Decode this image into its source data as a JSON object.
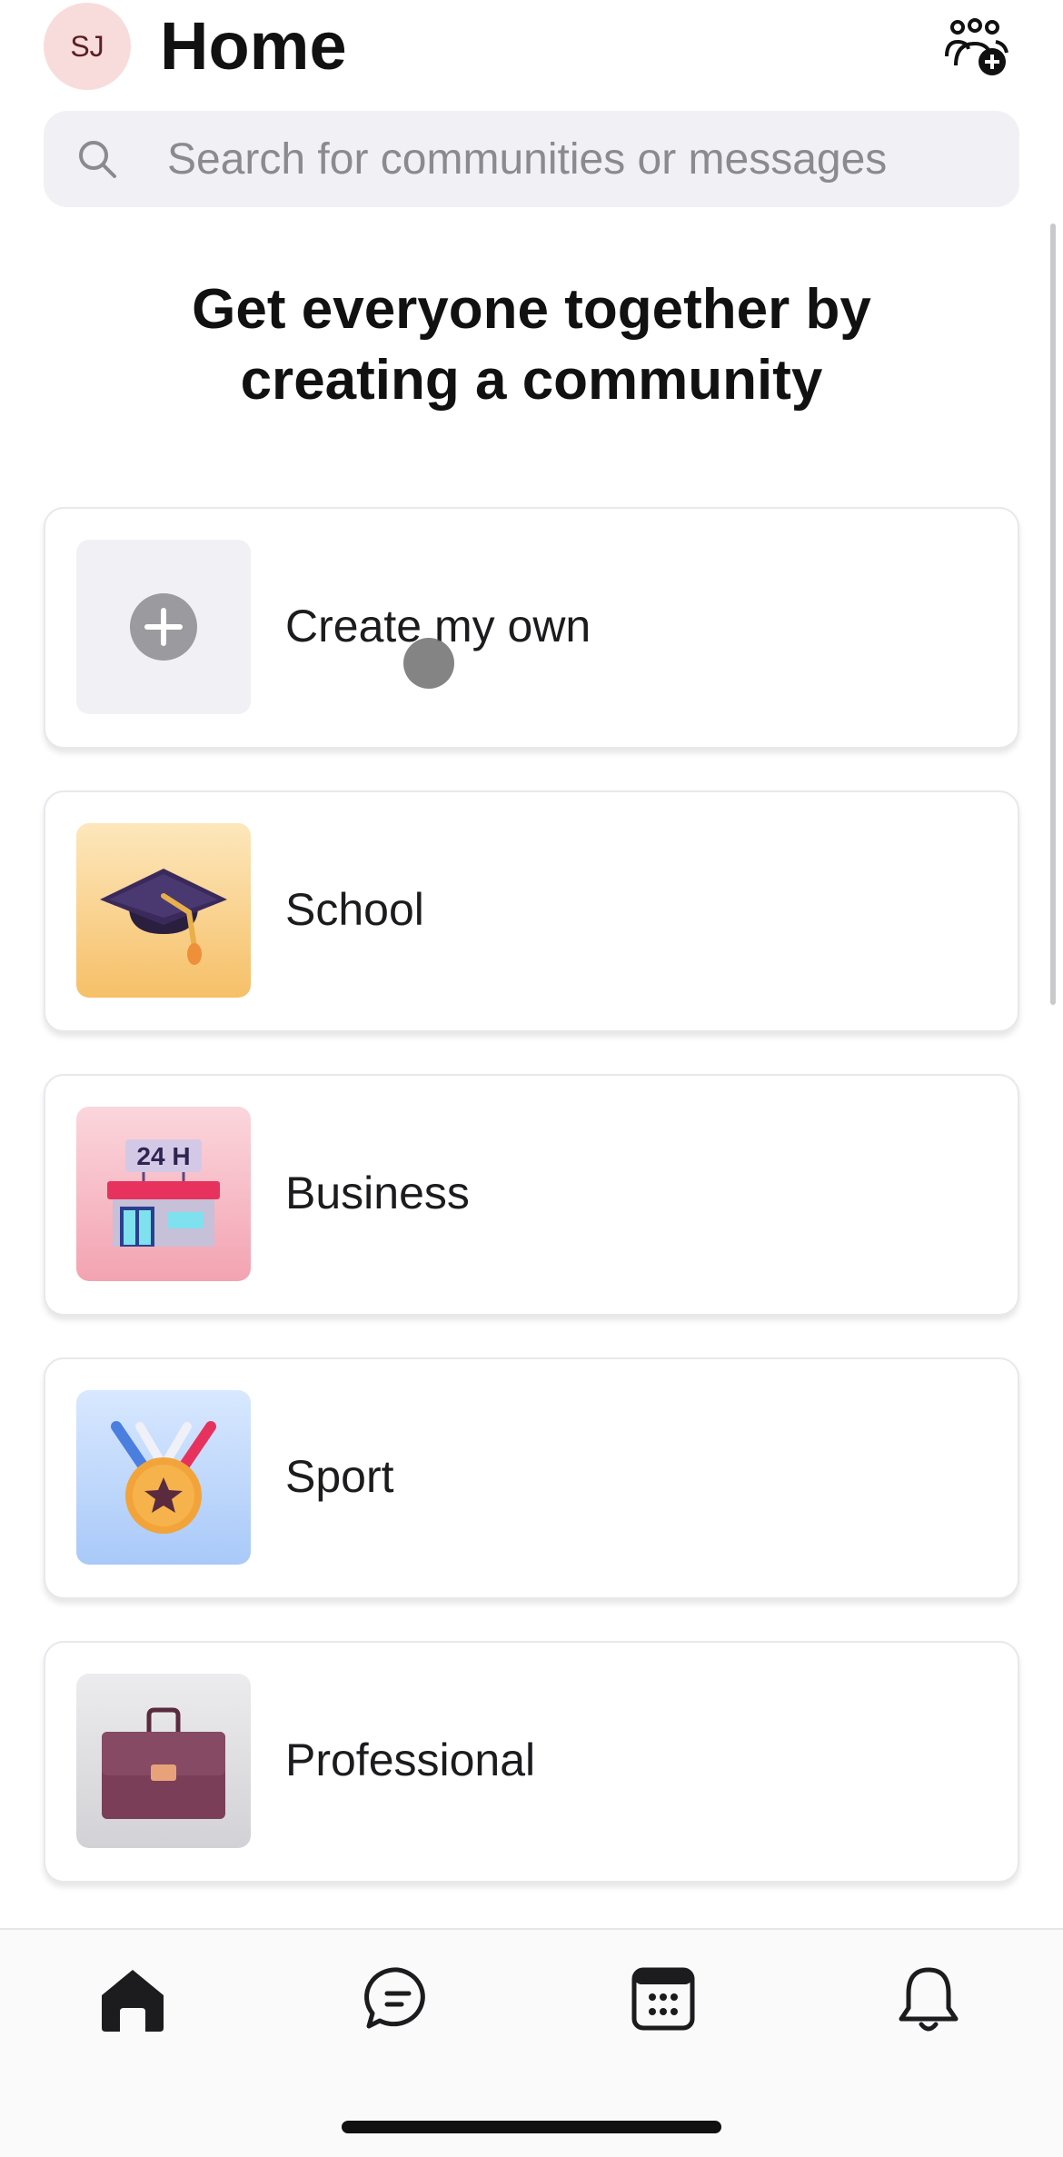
{
  "header": {
    "avatar_initials": "SJ",
    "title": "Home",
    "new_community_icon": "people-add-icon"
  },
  "search": {
    "placeholder": "Search for communities or messages",
    "value": ""
  },
  "headline": "Get everyone together by creating a community",
  "cards": [
    {
      "label": "Create my own",
      "icon": "plus-icon"
    },
    {
      "label": "School",
      "icon": "graduation-cap-icon"
    },
    {
      "label": "Business",
      "icon": "storefront-24h-icon"
    },
    {
      "label": "Sport",
      "icon": "medal-icon"
    },
    {
      "label": "Professional",
      "icon": "briefcase-icon"
    }
  ],
  "tabs": [
    {
      "name": "home",
      "icon": "home-icon",
      "active": true
    },
    {
      "name": "chats",
      "icon": "chat-bubble-icon",
      "active": false
    },
    {
      "name": "calendar",
      "icon": "calendar-icon",
      "active": false
    },
    {
      "name": "activity",
      "icon": "bell-icon",
      "active": false
    }
  ],
  "colors": {
    "avatar_bg": "#f8dcdc",
    "search_bg": "#f1f0f4",
    "text": "#111111"
  }
}
